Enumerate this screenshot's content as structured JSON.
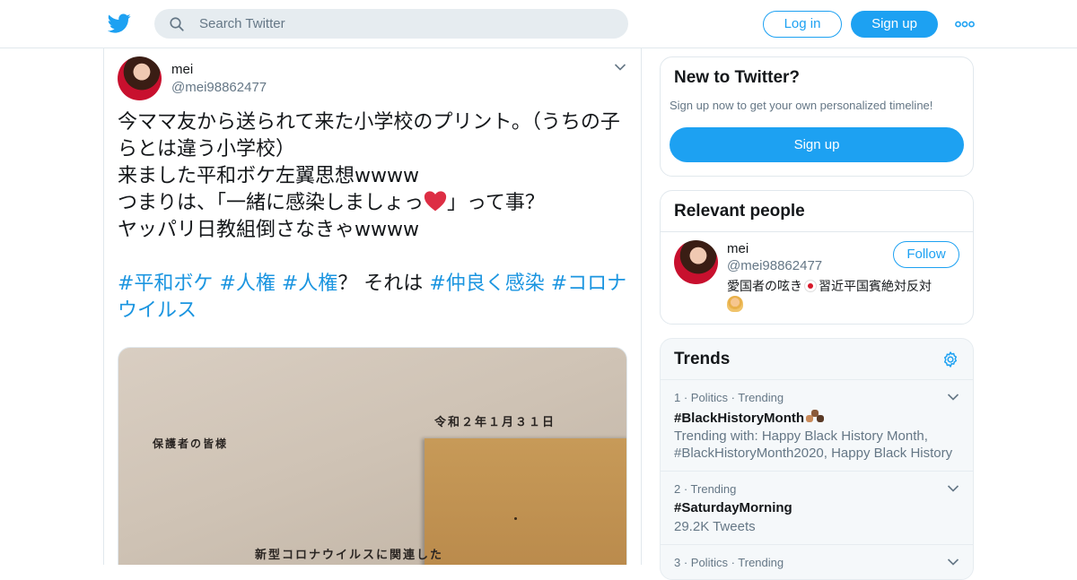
{
  "header": {
    "search_placeholder": "Search Twitter",
    "login_label": "Log in",
    "signup_label": "Sign up"
  },
  "tweet": {
    "name": "mei",
    "handle": "@mei98862477",
    "text_line1": "今ママ友から送られて来た小学校のプリント。（うちの子らとは違う小学校）",
    "text_line2": "来ました平和ボケ左翼思想wwww",
    "text_line3a": "つまりは、「一緒に感染しましょっ",
    "text_line3b": "」って事？",
    "text_line4": "ヤッパリ日教組倒さなきゃwwww",
    "hashtag1": "#平和ボケ",
    "hashtag2": "#人権",
    "hashtag3": "#人権",
    "mid_text": "？ それは",
    "hashtag4": "#仲良く感染",
    "hashtag5": "#コロナウイルス",
    "photo": {
      "date_text": "令和２年１月３１日",
      "addressee": "保護者の皆様",
      "body_line1": "新型コロナウイルスに関連した"
    }
  },
  "new_to_twitter": {
    "title": "New to Twitter?",
    "subtitle": "Sign up now to get your own personalized timeline!",
    "button": "Sign up"
  },
  "relevant_people": {
    "title": "Relevant people",
    "name": "mei",
    "handle": "@mei98862477",
    "follow_label": "Follow",
    "bio_a": "愛国者の呟き",
    "bio_b": "習近平国賓絶対反対"
  },
  "trends": {
    "title": "Trends",
    "items": [
      {
        "meta": "1 · Politics · Trending",
        "tag": "#BlackHistoryMonth",
        "desc": "Trending with: Happy Black History Month, #BlackHistoryMonth2020, Happy Black History"
      },
      {
        "meta": "2 · Trending",
        "tag": "#SaturdayMorning",
        "desc": "29.2K Tweets"
      },
      {
        "meta": "3 · Politics · Trending",
        "tag": "",
        "desc": ""
      }
    ]
  },
  "colors": {
    "brand": "#1da1f2",
    "hashtag": "#1b95e0",
    "muted": "#657786"
  }
}
